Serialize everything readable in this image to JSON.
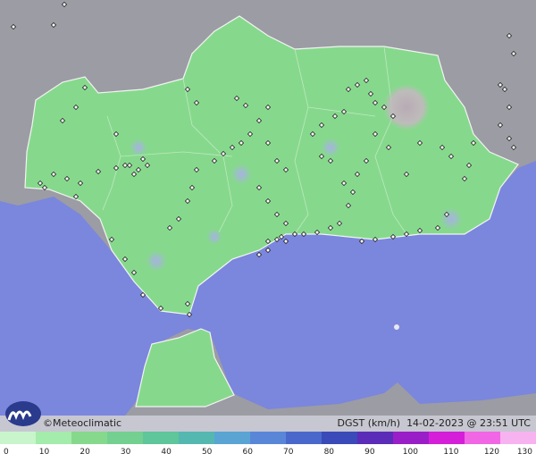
{
  "map": {
    "brand": "Meteoclimatic",
    "copyright_symbol": "©",
    "variable": "DGST (km/h)",
    "timestamp": "14-02-2023 @ 23:51 UTC",
    "colors": {
      "sea": "#7b86dd",
      "land_outside": "#9c9ca4",
      "region_fill": "#86d98c",
      "gust_hotspot": "#a9b0e8",
      "high_gust_patch": "#b0a8b4"
    },
    "scale_labels": [
      "0",
      "10",
      "20",
      "30",
      "40",
      "50",
      "60",
      "70",
      "80",
      "90",
      "100",
      "110",
      "120",
      "130"
    ]
  }
}
